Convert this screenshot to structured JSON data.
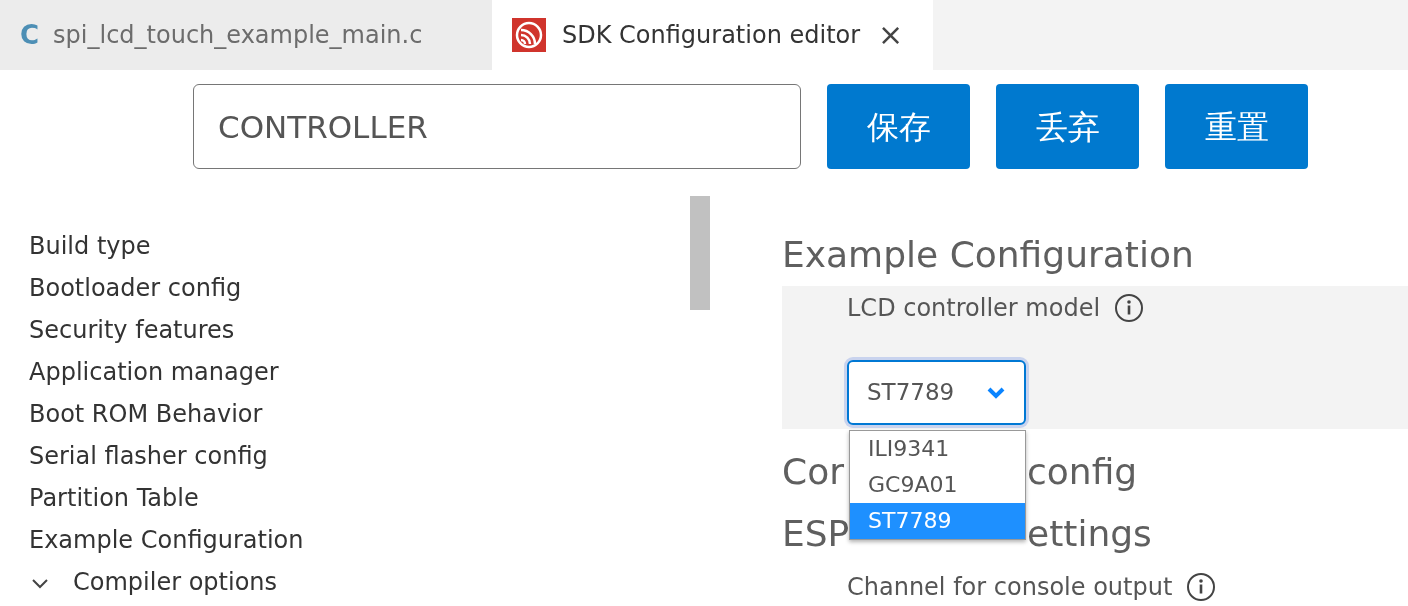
{
  "tabs": [
    {
      "kind": "c-file",
      "icon_text": "C",
      "label": "spi_lcd_touch_example_main.c",
      "selected": false
    },
    {
      "kind": "config",
      "label": "SDK Configuration editor",
      "close": "×",
      "selected": true
    }
  ],
  "search": {
    "value": "CONTROLLER"
  },
  "buttons": [
    "保存",
    "丢弃",
    "重置"
  ],
  "sidebar": {
    "items": [
      {
        "label": "Build type"
      },
      {
        "label": "Bootloader config"
      },
      {
        "label": "Security features"
      },
      {
        "label": "Application manager"
      },
      {
        "label": "Boot ROM Behavior"
      },
      {
        "label": "Serial flasher config"
      },
      {
        "label": "Partition Table"
      },
      {
        "label": "Example Configuration"
      },
      {
        "label": "Compiler options",
        "expanded": true
      }
    ]
  },
  "sections": [
    {
      "title": "Example Configuration",
      "options": [
        {
          "label": "LCD controller model",
          "value": "ST7789",
          "dropdown_open": true,
          "choices": [
            {
              "label": "ILI9341",
              "selected": false
            },
            {
              "label": "GC9A01",
              "selected": false
            },
            {
              "label": "ST7789",
              "selected": true
            }
          ]
        }
      ]
    },
    {
      "title_parts": [
        "Cor",
        "config"
      ]
    },
    {
      "title_parts": [
        "ESP",
        "ettings"
      ],
      "options": [
        {
          "label": "Channel for console output"
        }
      ]
    }
  ]
}
